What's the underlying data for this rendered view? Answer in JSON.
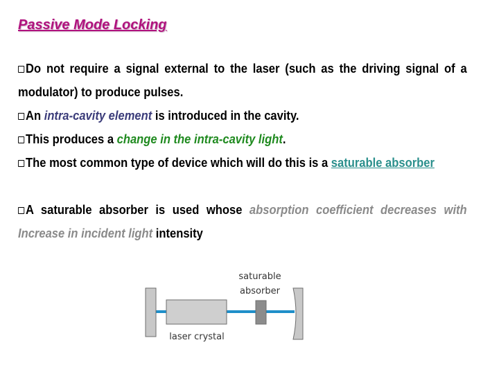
{
  "slide": {
    "title": "Passive Mode Locking",
    "bullets": [
      {
        "parts": [
          {
            "text": "Do not require a signal external to the laser (such as the driving signal of a modulator) to produce pulses.",
            "style": "plain"
          }
        ]
      },
      {
        "parts": [
          {
            "text": "An ",
            "style": "plain"
          },
          {
            "text": "intra-cavity element",
            "style": "italic-blue"
          },
          {
            "text": " is introduced in the cavity.",
            "style": "plain"
          }
        ]
      },
      {
        "parts": [
          {
            "text": "This produces a ",
            "style": "plain"
          },
          {
            "text": "change in the intra-cavity light",
            "style": "italic-green"
          },
          {
            "text": ".",
            "style": "plain"
          }
        ]
      },
      {
        "parts": [
          {
            "text": "The most common type of device which will do this is a ",
            "style": "plain"
          },
          {
            "text": "saturable absorber",
            "style": "link-teal"
          }
        ]
      },
      {
        "parts": [
          {
            "text": "A saturable absorber is used whose ",
            "style": "plain"
          },
          {
            "text": "absorption coefficient decreases with Increase in incident light",
            "style": "italic-gray"
          },
          {
            "text": " intensity",
            "style": "plain"
          }
        ]
      }
    ]
  },
  "diagram": {
    "labels": {
      "absorber_line1": "saturable",
      "absorber_line2": "absorber",
      "crystal": "laser crystal"
    },
    "colors": {
      "mirror_fill": "#c8c8c8",
      "mirror_stroke": "#6e6e6e",
      "crystal_fill": "#cfcfcf",
      "absorber_fill": "#8c8c8c",
      "beam": "#1f8fc9"
    }
  },
  "colors": {
    "title": "#b0127e",
    "italic_blue": "#3b3c7a",
    "italic_green": "#1f8a1f",
    "link_teal": "#2a8f8c",
    "italic_gray": "#8a8a8a"
  }
}
